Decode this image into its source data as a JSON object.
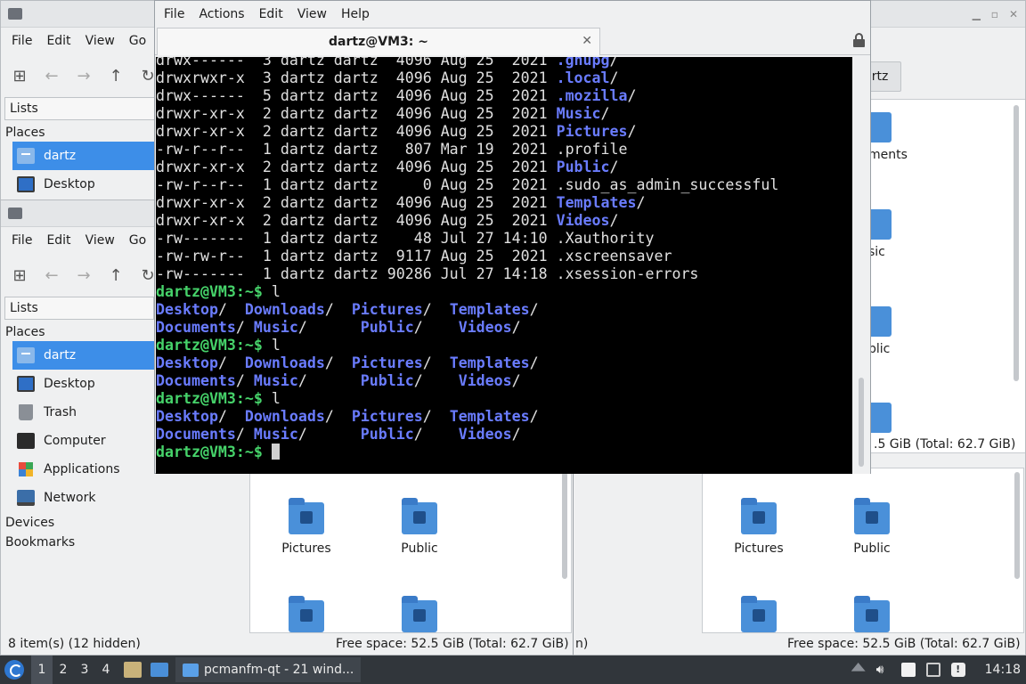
{
  "file_manager": {
    "menu": [
      "File",
      "Edit",
      "View",
      "Go"
    ],
    "sidebar_select": "Lists",
    "places_label": "Places",
    "places": [
      {
        "label": "dartz",
        "icon": "home-folder-icon",
        "selected": true
      },
      {
        "label": "Desktop",
        "icon": "desktop-icon"
      },
      {
        "label": "Trash",
        "icon": "trash-icon"
      },
      {
        "label": "Computer",
        "icon": "computer-icon"
      },
      {
        "label": "Applications",
        "icon": "applications-icon"
      },
      {
        "label": "Network",
        "icon": "network-icon"
      }
    ],
    "devices_label": "Devices",
    "bookmarks_label": "Bookmarks",
    "status_left": "8 item(s) (12 hidden)",
    "free_space": "Free space: 52.5 GiB (Total: 62.7 GiB)",
    "partial_free_space": ".5 GiB (Total: 62.7 GiB)",
    "partial_status_left": "n)",
    "partial_path": "rtz",
    "partial_labels": [
      "ments",
      "sic",
      "blic"
    ],
    "folders": [
      "Pictures",
      "Public"
    ]
  },
  "terminal": {
    "menu": [
      "File",
      "Actions",
      "Edit",
      "View",
      "Help"
    ],
    "tab_title": "dartz@VM3: ~",
    "prompt": "dartz@VM3",
    "prompt_path": ":~$",
    "command": " l",
    "listing": [
      {
        "perm": "drwx------",
        "links": "3",
        "user": "dartz",
        "group": "dartz",
        "size": " 4096",
        "date": "Aug 25  2021",
        "name": ".gnupg",
        "dir": true
      },
      {
        "perm": "drwxrwxr-x",
        "links": "3",
        "user": "dartz",
        "group": "dartz",
        "size": " 4096",
        "date": "Aug 25  2021",
        "name": ".local",
        "dir": true
      },
      {
        "perm": "drwx------",
        "links": "5",
        "user": "dartz",
        "group": "dartz",
        "size": " 4096",
        "date": "Aug 25  2021",
        "name": ".mozilla",
        "dir": true
      },
      {
        "perm": "drwxr-xr-x",
        "links": "2",
        "user": "dartz",
        "group": "dartz",
        "size": " 4096",
        "date": "Aug 25  2021",
        "name": "Music",
        "dir": true
      },
      {
        "perm": "drwxr-xr-x",
        "links": "2",
        "user": "dartz",
        "group": "dartz",
        "size": " 4096",
        "date": "Aug 25  2021",
        "name": "Pictures",
        "dir": true
      },
      {
        "perm": "-rw-r--r--",
        "links": "1",
        "user": "dartz",
        "group": "dartz",
        "size": "  807",
        "date": "Mar 19  2021",
        "name": ".profile",
        "dir": false
      },
      {
        "perm": "drwxr-xr-x",
        "links": "2",
        "user": "dartz",
        "group": "dartz",
        "size": " 4096",
        "date": "Aug 25  2021",
        "name": "Public",
        "dir": true
      },
      {
        "perm": "-rw-r--r--",
        "links": "1",
        "user": "dartz",
        "group": "dartz",
        "size": "    0",
        "date": "Aug 25  2021",
        "name": ".sudo_as_admin_successful",
        "dir": false
      },
      {
        "perm": "drwxr-xr-x",
        "links": "2",
        "user": "dartz",
        "group": "dartz",
        "size": " 4096",
        "date": "Aug 25  2021",
        "name": "Templates",
        "dir": true
      },
      {
        "perm": "drwxr-xr-x",
        "links": "2",
        "user": "dartz",
        "group": "dartz",
        "size": " 4096",
        "date": "Aug 25  2021",
        "name": "Videos",
        "dir": true
      },
      {
        "perm": "-rw-------",
        "links": "1",
        "user": "dartz",
        "group": "dartz",
        "size": "   48",
        "date": "Jul 27 14:10",
        "name": ".Xauthority",
        "dir": false
      },
      {
        "perm": "-rw-rw-r--",
        "links": "1",
        "user": "dartz",
        "group": "dartz",
        "size": " 9117",
        "date": "Aug 25  2021",
        "name": ".xscreensaver",
        "dir": false
      },
      {
        "perm": "-rw-------",
        "links": "1",
        "user": "dartz",
        "group": "dartz",
        "size": "90286",
        "date": "Jul 27 14:18",
        "name": ".xsession-errors",
        "dir": false
      }
    ],
    "ls_rows": [
      [
        "Desktop/",
        "Downloads/",
        "Pictures/",
        "Templates/"
      ],
      [
        "Documents/",
        "Music/",
        "Public/",
        "Videos/"
      ]
    ],
    "repeat_count": 3
  },
  "taskbar": {
    "workspaces": [
      "1",
      "2",
      "3",
      "4"
    ],
    "task_label": "pcmanfm-qt - 21 wind...",
    "clock": "14:18"
  }
}
